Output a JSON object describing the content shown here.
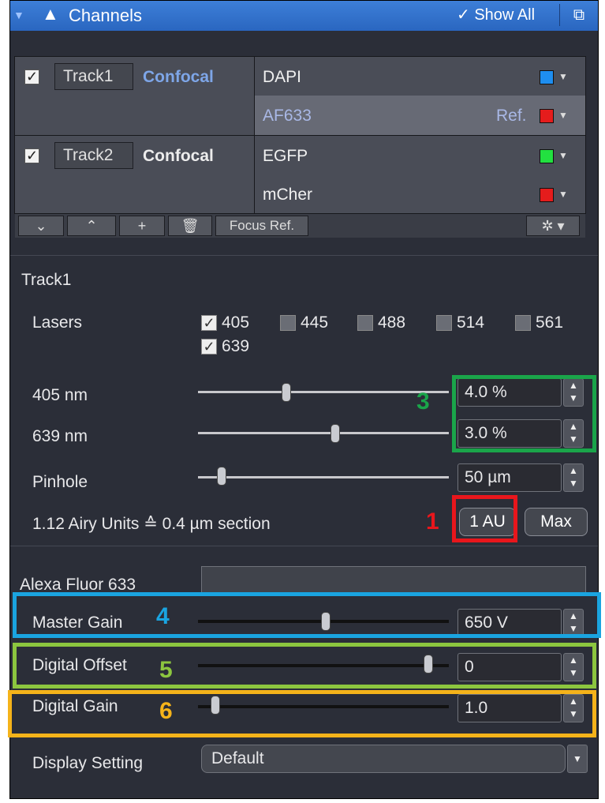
{
  "header": {
    "title": "Channels",
    "show_all": "✓ Show All"
  },
  "tracks": [
    {
      "enabled": true,
      "name": "Track1",
      "mode": "Confocal",
      "channels": [
        {
          "name": "DAPI",
          "ref": "",
          "color": "#1e8ef0"
        },
        {
          "name": "AF633",
          "ref": "Ref.",
          "color": "#e51c1c"
        }
      ]
    },
    {
      "enabled": true,
      "name": "Track2",
      "mode": "Confocal",
      "channels": [
        {
          "name": "EGFP",
          "ref": "",
          "color": "#22e040"
        },
        {
          "name": "mCher",
          "ref": "",
          "color": "#e51c1c"
        }
      ]
    }
  ],
  "track_toolbar": {
    "focus_ref": "Focus Ref."
  },
  "detail": {
    "track_title": "Track1",
    "lasers_label": "Lasers",
    "lasers": [
      {
        "label": "405",
        "checked": true
      },
      {
        "label": "445",
        "checked": false
      },
      {
        "label": "488",
        "checked": false
      },
      {
        "label": "514",
        "checked": false
      },
      {
        "label": "561",
        "checked": false
      },
      {
        "label": "639",
        "checked": true
      }
    ],
    "laser_405": {
      "label": "405 nm",
      "value": "4.0 %"
    },
    "laser_639": {
      "label": "639 nm",
      "value": "3.0 %"
    },
    "pinhole": {
      "label": "Pinhole",
      "value": "50 µm"
    },
    "airy": {
      "text": "1.12 Airy Units ≙ 0.4 µm section",
      "one_au": "1 AU",
      "max": "Max"
    },
    "detector_name": "Alexa Fluor 633",
    "master_gain": {
      "label": "Master Gain",
      "value": "650 V"
    },
    "digital_offset": {
      "label": "Digital Offset",
      "value": "0"
    },
    "digital_gain": {
      "label": "Digital Gain",
      "value": "1.0"
    },
    "display_setting": {
      "label": "Display Setting",
      "value": "Default"
    }
  },
  "annotations": [
    {
      "number": "1",
      "color": "#e8161c"
    },
    {
      "number": "3",
      "color": "#1aa54a"
    },
    {
      "number": "4",
      "color": "#1aa4e0"
    },
    {
      "number": "5",
      "color": "#8cc63f"
    },
    {
      "number": "6",
      "color": "#f5b31a"
    }
  ]
}
